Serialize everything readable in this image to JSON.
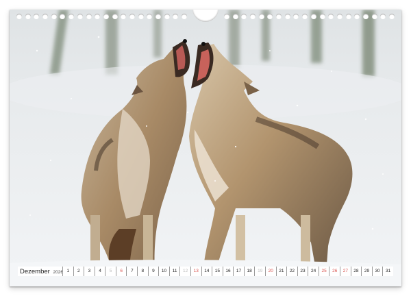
{
  "calendar": {
    "month": "Dezember",
    "year": "2026",
    "days": [
      {
        "n": "1",
        "kind": "weekday"
      },
      {
        "n": "2",
        "kind": "weekday"
      },
      {
        "n": "3",
        "kind": "weekday"
      },
      {
        "n": "4",
        "kind": "weekday"
      },
      {
        "n": "5",
        "kind": "faint"
      },
      {
        "n": "6",
        "kind": "sun"
      },
      {
        "n": "7",
        "kind": "weekday"
      },
      {
        "n": "8",
        "kind": "weekday"
      },
      {
        "n": "9",
        "kind": "weekday"
      },
      {
        "n": "10",
        "kind": "weekday"
      },
      {
        "n": "11",
        "kind": "weekday"
      },
      {
        "n": "12",
        "kind": "faint"
      },
      {
        "n": "13",
        "kind": "sun"
      },
      {
        "n": "14",
        "kind": "weekday"
      },
      {
        "n": "15",
        "kind": "weekday"
      },
      {
        "n": "16",
        "kind": "weekday"
      },
      {
        "n": "17",
        "kind": "weekday"
      },
      {
        "n": "18",
        "kind": "weekday"
      },
      {
        "n": "19",
        "kind": "faint"
      },
      {
        "n": "20",
        "kind": "sun"
      },
      {
        "n": "21",
        "kind": "weekday"
      },
      {
        "n": "22",
        "kind": "weekday"
      },
      {
        "n": "23",
        "kind": "weekday"
      },
      {
        "n": "24",
        "kind": "weekday"
      },
      {
        "n": "25",
        "kind": "sun"
      },
      {
        "n": "26",
        "kind": "sun"
      },
      {
        "n": "27",
        "kind": "sun"
      },
      {
        "n": "28",
        "kind": "weekday"
      },
      {
        "n": "29",
        "kind": "weekday"
      },
      {
        "n": "30",
        "kind": "weekday"
      },
      {
        "n": "31",
        "kind": "weekday"
      }
    ]
  },
  "photo": {
    "subject": "two-grey-wolves-howling-in-snow",
    "colors": {
      "snow": "#eef0f2",
      "fur_light": "#d9c8ae",
      "fur_mid": "#a98c69",
      "fur_dark": "#5e4d3c",
      "tree": "#7d8a78"
    }
  },
  "binding": {
    "hole_count_per_side": 20
  }
}
